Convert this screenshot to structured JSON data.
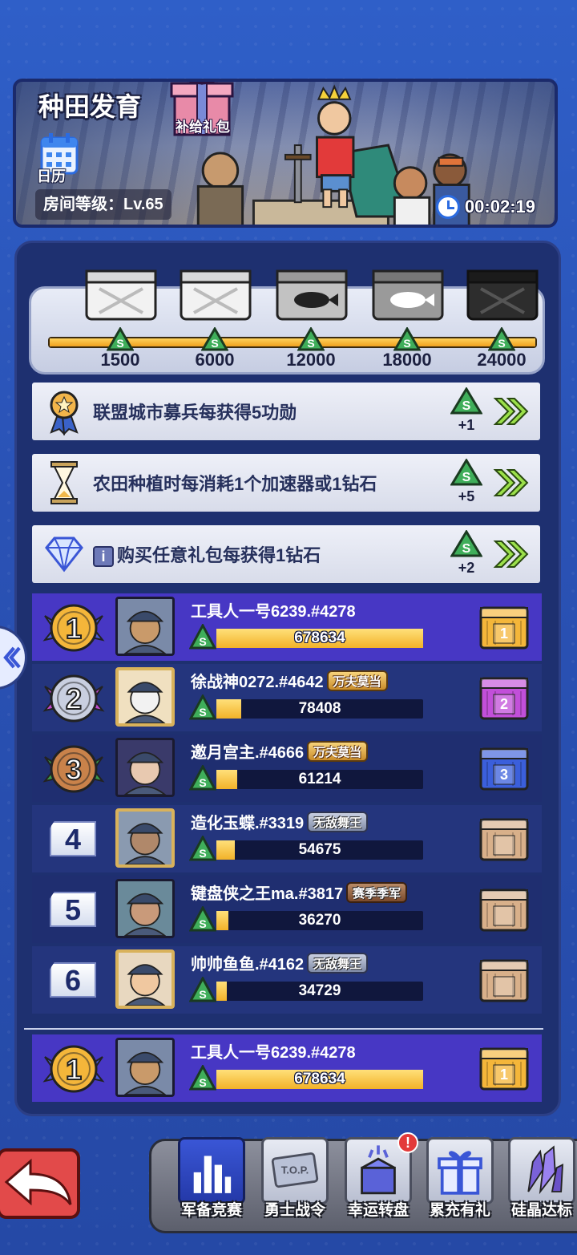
{
  "banner": {
    "title": "种田发育",
    "gift_label": "补给礼包",
    "calendar_label": "日历",
    "room_level": "房间等级：Lv.65",
    "timer": "00:02:19"
  },
  "milestones": {
    "values": [
      "1500",
      "6000",
      "12000",
      "18000",
      "24000"
    ],
    "progress_fraction": 1.0
  },
  "tasks": [
    {
      "text": "联盟城市募兵每获得5功勋",
      "reward": "+1",
      "icon": "medal-star-icon"
    },
    {
      "text": "农田种植时每消耗1个加速器或1钻石",
      "reward": "+5",
      "icon": "hourglass-icon"
    },
    {
      "text": "购买任意礼包每获得1钻石",
      "reward": "+2",
      "icon": "diamond-icon",
      "info": "i"
    }
  ],
  "leaderboard": [
    {
      "rank": "1",
      "name": "工具人一号6239.#4278",
      "score": "678634",
      "fill": 1.0,
      "title": "",
      "chest_label": "1",
      "chest_color": "#f4b63a"
    },
    {
      "rank": "2",
      "name": "徐战神0272.#4642",
      "score": "78408",
      "fill": 0.12,
      "title": "万夫莫当",
      "title_style": "gold",
      "chest_label": "2",
      "chest_color": "#c24fd9"
    },
    {
      "rank": "3",
      "name": "邀月宫主.#4666",
      "score": "61214",
      "fill": 0.1,
      "title": "万夫莫当",
      "title_style": "gold",
      "chest_label": "3",
      "chest_color": "#3b5fdb"
    },
    {
      "rank": "4",
      "name": "造化玉蝶.#3319",
      "score": "54675",
      "fill": 0.09,
      "title": "无敌舞王",
      "title_style": "silver",
      "chest_label": "",
      "chest_color": "#d8b08a"
    },
    {
      "rank": "5",
      "name": "键盘侠之王ma.#3817",
      "score": "36270",
      "fill": 0.06,
      "title": "赛季季军",
      "title_style": "copper",
      "chest_label": "",
      "chest_color": "#d8b08a"
    },
    {
      "rank": "6",
      "name": "帅帅鱼鱼.#4162",
      "score": "34729",
      "fill": 0.05,
      "title": "无敌舞王",
      "title_style": "silver",
      "chest_label": "",
      "chest_color": "#d8b08a"
    }
  ],
  "my_rank": {
    "rank": "1",
    "name": "工具人一号6239.#4278",
    "score": "678634",
    "fill": 1.0,
    "chest_label": "1"
  },
  "nav": [
    {
      "label": "军备竞赛",
      "icon": "bar-chart-icon",
      "active": true
    },
    {
      "label": "勇士战令",
      "icon": "top-ticket-icon",
      "active": false
    },
    {
      "label": "幸运转盘",
      "icon": "lucky-box-icon",
      "active": false,
      "badge": "!"
    },
    {
      "label": "累充有礼",
      "icon": "gift-icon",
      "active": false
    },
    {
      "label": "硅晶达标",
      "icon": "crystal-icon",
      "active": false
    }
  ],
  "colors": {
    "accent": "#4737c4",
    "panel": "#1e3070",
    "bar_gold": "#f2b229"
  }
}
